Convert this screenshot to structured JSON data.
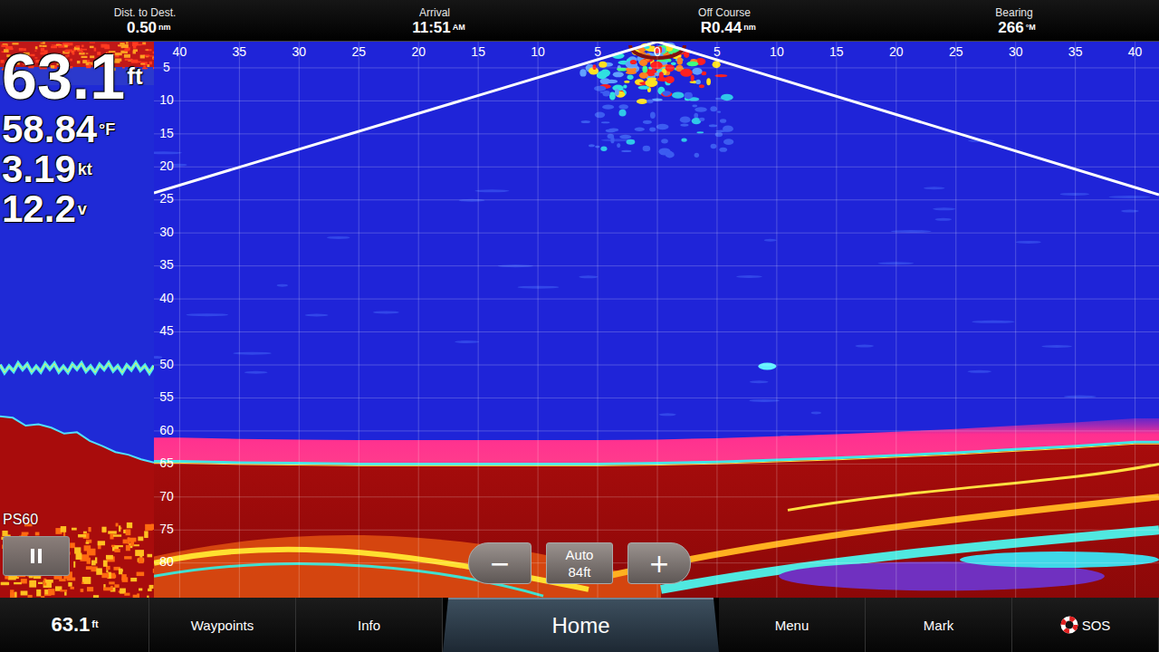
{
  "top_bar": {
    "fields": [
      {
        "label": "Dist. to Dest.",
        "value": "0.50",
        "unit": "nm"
      },
      {
        "label": "Arrival",
        "value": "11:51",
        "unit": "AM"
      },
      {
        "label": "Off Course",
        "value": "R0.44",
        "unit": "nm"
      },
      {
        "label": "Bearing",
        "value": "266",
        "unit": "°M"
      }
    ]
  },
  "history": {
    "readings": [
      {
        "value": "63.1",
        "unit": "ft"
      },
      {
        "value": "58.84",
        "unit": "°F"
      },
      {
        "value": "3.19",
        "unit": "kt"
      },
      {
        "value": "12.2",
        "unit": "v"
      }
    ],
    "mode": "PS60",
    "paused": false,
    "bottom_ft": [
      57.8,
      58.0,
      59.2,
      59.0,
      59.5,
      60.4,
      60.2,
      61.5,
      62.3,
      63.2,
      63.6,
      64.3,
      64.8
    ],
    "fish_band_ft": 50.5
  },
  "sonar": {
    "range_scale": [
      "40",
      "35",
      "30",
      "25",
      "20",
      "15",
      "10",
      "5",
      "0",
      "5",
      "10",
      "15",
      "20",
      "25",
      "30",
      "35",
      "40"
    ],
    "depth_scale": [
      "5",
      "10",
      "15",
      "20",
      "25",
      "30",
      "35",
      "40",
      "45",
      "50",
      "55",
      "60",
      "65",
      "70",
      "75",
      "80"
    ],
    "bottom_ft": [
      64.6,
      64.8,
      64.9,
      65.0,
      65.0,
      65.0,
      65.0,
      65.0,
      64.9,
      64.7,
      64.4,
      64.1,
      63.7,
      63.3,
      62.8,
      62.3,
      61.7
    ],
    "fish_targets": [
      {
        "range_ft": 9.2,
        "depth_ft": 50.2
      }
    ]
  },
  "zoom": {
    "minus": "−",
    "mode": "Auto",
    "range": "84ft",
    "plus": "+"
  },
  "bottom_bar": {
    "depth": {
      "value": "63.1",
      "unit": "ft"
    },
    "items": [
      {
        "label": "Waypoints",
        "kind": "button",
        "selected": false
      },
      {
        "label": "Info",
        "kind": "button",
        "selected": false
      },
      {
        "label": "Home",
        "kind": "tab",
        "selected": true
      },
      {
        "label": "Menu",
        "kind": "button",
        "selected": false
      },
      {
        "label": "Mark",
        "kind": "button",
        "selected": false
      },
      {
        "label": "SOS",
        "kind": "sos",
        "selected": false
      }
    ]
  }
}
